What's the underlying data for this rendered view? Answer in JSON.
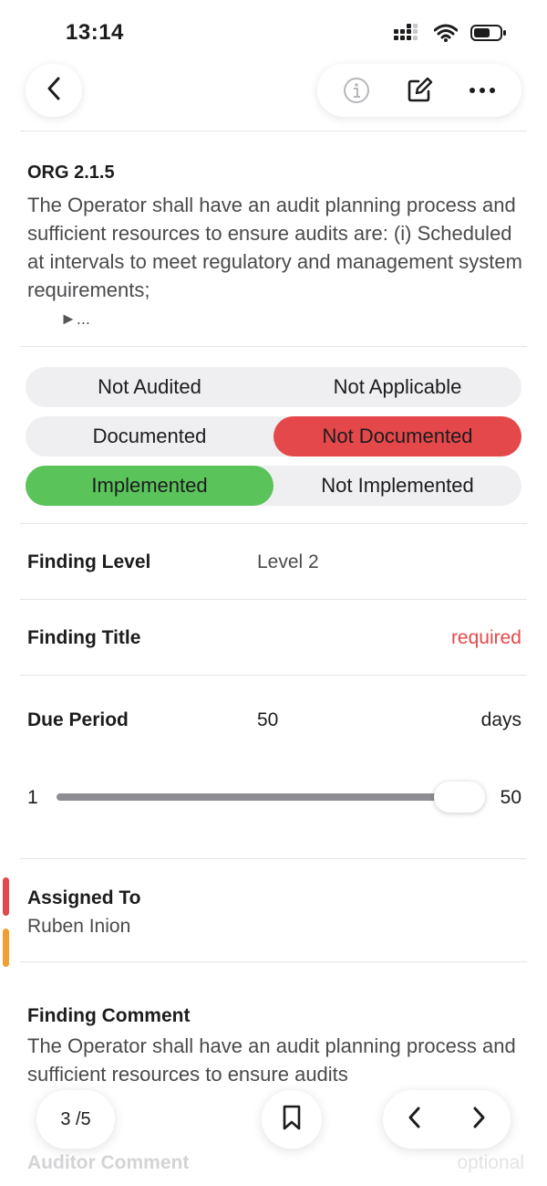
{
  "status_bar": {
    "time": "13:14",
    "icons": [
      "signal-icon",
      "wifi-icon",
      "battery-icon"
    ]
  },
  "nav": {
    "icons": [
      "back-chevron-icon",
      "info-icon",
      "edit-icon",
      "more-icon"
    ]
  },
  "requirement": {
    "code": "ORG 2.1.5",
    "text": "The Operator shall have an audit planning process and sufficient resources to ensure audits are: (i) Scheduled at intervals to meet regulatory and management system requirements;",
    "more": "►..."
  },
  "audit_status": {
    "options": [
      {
        "label": "Not Audited",
        "selected": false
      },
      {
        "label": "Not Applicable",
        "selected": false
      },
      {
        "label": "Documented",
        "selected": false
      },
      {
        "label": "Not Documented",
        "selected": true,
        "color": "#e5484a"
      },
      {
        "label": "Implemented",
        "selected": true,
        "color": "#5ac35a"
      },
      {
        "label": "Not Implemented",
        "selected": false
      }
    ]
  },
  "finding_level": {
    "label": "Finding Level",
    "value": "Level 2"
  },
  "finding_title": {
    "label": "Finding Title",
    "placeholder": "required",
    "placeholder_color": "#e5484a"
  },
  "due_period": {
    "label": "Due Period",
    "value": "50",
    "unit": "days",
    "slider": {
      "min": "1",
      "max": "50",
      "current": 50
    }
  },
  "assigned_to": {
    "label": "Assigned To",
    "value": "Ruben Inion",
    "markers": [
      "#e5484a",
      "#f0a030"
    ]
  },
  "finding_comment": {
    "label": "Finding Comment",
    "text": "The Operator shall have an audit planning process and sufficient resources to ensure audits"
  },
  "auditor_comment": {
    "label": "Auditor Comment",
    "placeholder": "optional"
  },
  "bottom_bar": {
    "page_indicator": "3 /5",
    "icons": [
      "bookmark-icon",
      "chevron-left-icon",
      "chevron-right-icon"
    ]
  }
}
